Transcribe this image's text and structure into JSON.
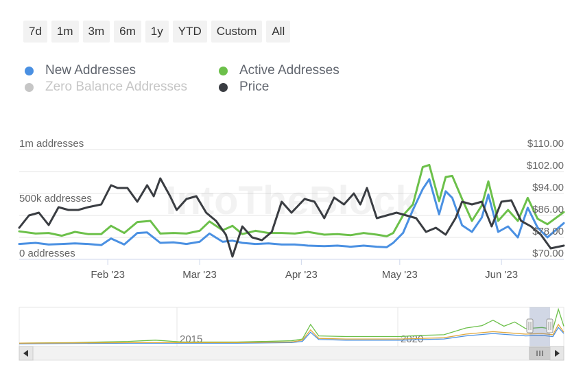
{
  "range_buttons": [
    "7d",
    "1m",
    "3m",
    "6m",
    "1y",
    "YTD",
    "Custom",
    "All"
  ],
  "legend": [
    {
      "label": "New Addresses",
      "color": "#4a90e2",
      "visible": true
    },
    {
      "label": "Active Addresses",
      "color": "#6cc04a",
      "visible": true
    },
    {
      "label": "Zero Balance Addresses",
      "color": "#c6c6c6",
      "visible": false
    },
    {
      "label": "Price",
      "color": "#3a3d42",
      "visible": true
    }
  ],
  "watermark": "IntoTheBlock",
  "chart_data": {
    "type": "line",
    "x_start": "2023-01-05",
    "x_end": "2023-06-20",
    "x_tick_labels": [
      {
        "label": "Feb '23",
        "date": "2023-02-01"
      },
      {
        "label": "Mar '23",
        "date": "2023-03-01"
      },
      {
        "label": "Apr '23",
        "date": "2023-04-01"
      },
      {
        "label": "May '23",
        "date": "2023-05-01"
      },
      {
        "label": "Jun '23",
        "date": "2023-06-01"
      }
    ],
    "left_axis": {
      "ticks": [
        "0 addresses",
        "500k addresses",
        "1m addresses"
      ],
      "ylim": [
        0,
        1000000
      ]
    },
    "right_axis": {
      "ticks": [
        "$70.00",
        "$78.00",
        "$86.00",
        "$94.00",
        "$102.00",
        "$110.00"
      ],
      "ylim": [
        70,
        110
      ]
    },
    "grid": true,
    "series": [
      {
        "name": "Active Addresses",
        "axis": "left",
        "color": "#6cc04a",
        "points": [
          [
            "2023-01-05",
            255000
          ],
          [
            "2023-01-10",
            235000
          ],
          [
            "2023-01-14",
            240000
          ],
          [
            "2023-01-18",
            215000
          ],
          [
            "2023-01-22",
            250000
          ],
          [
            "2023-01-26",
            230000
          ],
          [
            "2023-01-30",
            230000
          ],
          [
            "2023-02-02",
            305000
          ],
          [
            "2023-02-06",
            240000
          ],
          [
            "2023-02-10",
            340000
          ],
          [
            "2023-02-14",
            350000
          ],
          [
            "2023-02-17",
            235000
          ],
          [
            "2023-02-21",
            240000
          ],
          [
            "2023-02-25",
            235000
          ],
          [
            "2023-03-01",
            260000
          ],
          [
            "2023-03-04",
            345000
          ],
          [
            "2023-03-08",
            265000
          ],
          [
            "2023-03-11",
            305000
          ],
          [
            "2023-03-14",
            230000
          ],
          [
            "2023-03-18",
            260000
          ],
          [
            "2023-03-22",
            240000
          ],
          [
            "2023-03-26",
            240000
          ],
          [
            "2023-03-30",
            235000
          ],
          [
            "2023-04-03",
            250000
          ],
          [
            "2023-04-08",
            225000
          ],
          [
            "2023-04-12",
            230000
          ],
          [
            "2023-04-16",
            220000
          ],
          [
            "2023-04-20",
            240000
          ],
          [
            "2023-04-24",
            225000
          ],
          [
            "2023-04-27",
            210000
          ],
          [
            "2023-04-29",
            240000
          ],
          [
            "2023-05-02",
            400000
          ],
          [
            "2023-05-05",
            500000
          ],
          [
            "2023-05-08",
            840000
          ],
          [
            "2023-05-10",
            860000
          ],
          [
            "2023-05-13",
            530000
          ],
          [
            "2023-05-15",
            750000
          ],
          [
            "2023-05-17",
            760000
          ],
          [
            "2023-05-20",
            550000
          ],
          [
            "2023-05-23",
            350000
          ],
          [
            "2023-05-26",
            490000
          ],
          [
            "2023-05-28",
            710000
          ],
          [
            "2023-05-31",
            350000
          ],
          [
            "2023-06-03",
            450000
          ],
          [
            "2023-06-06",
            350000
          ],
          [
            "2023-06-09",
            560000
          ],
          [
            "2023-06-12",
            370000
          ],
          [
            "2023-06-15",
            320000
          ],
          [
            "2023-06-20",
            430000
          ]
        ]
      },
      {
        "name": "New Addresses",
        "axis": "left",
        "color": "#4a90e2",
        "points": [
          [
            "2023-01-05",
            140000
          ],
          [
            "2023-01-10",
            150000
          ],
          [
            "2023-01-14",
            135000
          ],
          [
            "2023-01-18",
            140000
          ],
          [
            "2023-01-22",
            145000
          ],
          [
            "2023-01-26",
            140000
          ],
          [
            "2023-01-30",
            130000
          ],
          [
            "2023-02-02",
            190000
          ],
          [
            "2023-02-06",
            135000
          ],
          [
            "2023-02-10",
            240000
          ],
          [
            "2023-02-13",
            245000
          ],
          [
            "2023-02-17",
            150000
          ],
          [
            "2023-02-21",
            155000
          ],
          [
            "2023-02-25",
            140000
          ],
          [
            "2023-03-01",
            160000
          ],
          [
            "2023-03-04",
            235000
          ],
          [
            "2023-03-08",
            160000
          ],
          [
            "2023-03-11",
            170000
          ],
          [
            "2023-03-14",
            150000
          ],
          [
            "2023-03-18",
            140000
          ],
          [
            "2023-03-22",
            145000
          ],
          [
            "2023-03-26",
            135000
          ],
          [
            "2023-03-30",
            135000
          ],
          [
            "2023-04-03",
            125000
          ],
          [
            "2023-04-08",
            120000
          ],
          [
            "2023-04-12",
            125000
          ],
          [
            "2023-04-16",
            115000
          ],
          [
            "2023-04-20",
            125000
          ],
          [
            "2023-04-24",
            115000
          ],
          [
            "2023-04-27",
            110000
          ],
          [
            "2023-04-29",
            150000
          ],
          [
            "2023-05-02",
            240000
          ],
          [
            "2023-05-05",
            450000
          ],
          [
            "2023-05-08",
            640000
          ],
          [
            "2023-05-10",
            730000
          ],
          [
            "2023-05-13",
            410000
          ],
          [
            "2023-05-15",
            620000
          ],
          [
            "2023-05-17",
            560000
          ],
          [
            "2023-05-20",
            310000
          ],
          [
            "2023-05-23",
            250000
          ],
          [
            "2023-05-26",
            380000
          ],
          [
            "2023-05-28",
            590000
          ],
          [
            "2023-05-31",
            250000
          ],
          [
            "2023-06-03",
            300000
          ],
          [
            "2023-06-06",
            200000
          ],
          [
            "2023-06-09",
            470000
          ],
          [
            "2023-06-12",
            290000
          ],
          [
            "2023-06-15",
            200000
          ],
          [
            "2023-06-20",
            330000
          ]
        ]
      },
      {
        "name": "Price",
        "axis": "right",
        "color": "#3a3d42",
        "points": [
          [
            "2023-01-05",
            81.5
          ],
          [
            "2023-01-08",
            86
          ],
          [
            "2023-01-11",
            87
          ],
          [
            "2023-01-14",
            82.5
          ],
          [
            "2023-01-17",
            89
          ],
          [
            "2023-01-20",
            88
          ],
          [
            "2023-01-23",
            88
          ],
          [
            "2023-01-26",
            89
          ],
          [
            "2023-01-30",
            90
          ],
          [
            "2023-02-02",
            97
          ],
          [
            "2023-02-04",
            96
          ],
          [
            "2023-02-07",
            96
          ],
          [
            "2023-02-10",
            91
          ],
          [
            "2023-02-13",
            97
          ],
          [
            "2023-02-15",
            93
          ],
          [
            "2023-02-17",
            99.5
          ],
          [
            "2023-02-20",
            93
          ],
          [
            "2023-02-22",
            88
          ],
          [
            "2023-02-25",
            92
          ],
          [
            "2023-02-28",
            93
          ],
          [
            "2023-03-03",
            87
          ],
          [
            "2023-03-06",
            84
          ],
          [
            "2023-03-09",
            79
          ],
          [
            "2023-03-11",
            71
          ],
          [
            "2023-03-14",
            82
          ],
          [
            "2023-03-17",
            78
          ],
          [
            "2023-03-20",
            77
          ],
          [
            "2023-03-23",
            80
          ],
          [
            "2023-03-26",
            91
          ],
          [
            "2023-03-29",
            87
          ],
          [
            "2023-04-02",
            92
          ],
          [
            "2023-04-05",
            91
          ],
          [
            "2023-04-08",
            85
          ],
          [
            "2023-04-11",
            92.5
          ],
          [
            "2023-04-14",
            90
          ],
          [
            "2023-04-17",
            94
          ],
          [
            "2023-04-19",
            90
          ],
          [
            "2023-04-21",
            96
          ],
          [
            "2023-04-24",
            85
          ],
          [
            "2023-04-27",
            86
          ],
          [
            "2023-04-30",
            87
          ],
          [
            "2023-05-03",
            86
          ],
          [
            "2023-05-06",
            85
          ],
          [
            "2023-05-09",
            80
          ],
          [
            "2023-05-12",
            81.5
          ],
          [
            "2023-05-15",
            79
          ],
          [
            "2023-05-18",
            85
          ],
          [
            "2023-05-20",
            91
          ],
          [
            "2023-05-23",
            90
          ],
          [
            "2023-05-26",
            91
          ],
          [
            "2023-05-29",
            82
          ],
          [
            "2023-06-01",
            91
          ],
          [
            "2023-06-04",
            91.5
          ],
          [
            "2023-06-07",
            84
          ],
          [
            "2023-06-10",
            82
          ],
          [
            "2023-06-13",
            79
          ],
          [
            "2023-06-16",
            74
          ],
          [
            "2023-06-20",
            75
          ]
        ]
      }
    ]
  },
  "navigator": {
    "year_labels": [
      "2015",
      "2020"
    ],
    "scroll_left_icon": "arrow-left-icon",
    "scroll_right_icon": "arrow-right-icon",
    "scroll_grip_icon": "grip-icon",
    "series": [
      {
        "name": "Active Addresses",
        "color": "#6cc04a",
        "points": [
          [
            0,
            2
          ],
          [
            0.1,
            3
          ],
          [
            0.2,
            5
          ],
          [
            0.25,
            7
          ],
          [
            0.3,
            4
          ],
          [
            0.4,
            4
          ],
          [
            0.45,
            5
          ],
          [
            0.5,
            6
          ],
          [
            0.52,
            9
          ],
          [
            0.535,
            33
          ],
          [
            0.55,
            14
          ],
          [
            0.6,
            13
          ],
          [
            0.7,
            13
          ],
          [
            0.74,
            15
          ],
          [
            0.78,
            16
          ],
          [
            0.82,
            27
          ],
          [
            0.85,
            31
          ],
          [
            0.87,
            40
          ],
          [
            0.89,
            30
          ],
          [
            0.91,
            37
          ],
          [
            0.93,
            26
          ],
          [
            0.96,
            28
          ],
          [
            0.98,
            25
          ],
          [
            0.99,
            58
          ],
          [
            1,
            30
          ]
        ]
      },
      {
        "name": "New Addresses",
        "color": "#4a90e2",
        "points": [
          [
            0,
            1
          ],
          [
            0.2,
            2
          ],
          [
            0.4,
            2
          ],
          [
            0.5,
            3
          ],
          [
            0.52,
            5
          ],
          [
            0.535,
            20
          ],
          [
            0.55,
            8
          ],
          [
            0.6,
            7
          ],
          [
            0.7,
            7
          ],
          [
            0.78,
            9
          ],
          [
            0.82,
            14
          ],
          [
            0.87,
            18
          ],
          [
            0.9,
            16
          ],
          [
            0.93,
            14
          ],
          [
            0.96,
            15
          ],
          [
            0.98,
            13
          ],
          [
            0.99,
            28
          ],
          [
            1,
            18
          ]
        ]
      },
      {
        "name": "Zero Balance Addresses",
        "color": "#e0a83e",
        "points": [
          [
            0,
            2
          ],
          [
            0.2,
            3
          ],
          [
            0.4,
            3
          ],
          [
            0.5,
            4
          ],
          [
            0.52,
            7
          ],
          [
            0.535,
            24
          ],
          [
            0.55,
            10
          ],
          [
            0.6,
            9
          ],
          [
            0.7,
            9
          ],
          [
            0.78,
            11
          ],
          [
            0.82,
            17
          ],
          [
            0.87,
            21
          ],
          [
            0.9,
            19
          ],
          [
            0.93,
            17
          ],
          [
            0.96,
            18
          ],
          [
            0.98,
            16
          ],
          [
            0.99,
            33
          ],
          [
            1,
            20
          ]
        ]
      }
    ]
  }
}
